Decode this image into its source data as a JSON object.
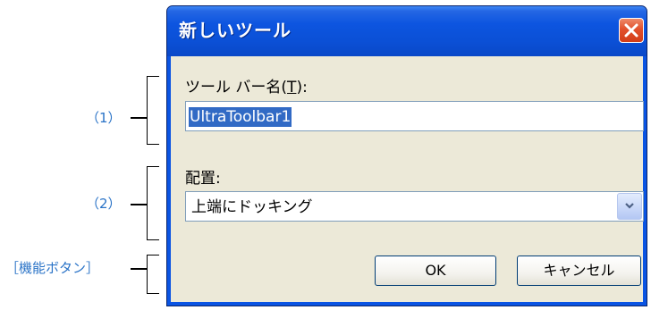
{
  "annotations": {
    "item1": "（1）",
    "item2": "（2）",
    "buttons": "［機能ボタン］"
  },
  "dialog": {
    "title": "新しいツール",
    "toolbar_name": {
      "label_prefix": "ツール バー名(",
      "label_accel": "T",
      "label_suffix": "):",
      "value": "UltraToolbar1"
    },
    "placement": {
      "label": "配置:",
      "selected": "上端にドッキング"
    },
    "ok_label": "OK",
    "cancel_label": "キャンセル"
  },
  "colors": {
    "annotation": "#2a73c7",
    "titlebar": "#0a54e3",
    "client": "#ece9d8",
    "selection": "#316ac5"
  }
}
